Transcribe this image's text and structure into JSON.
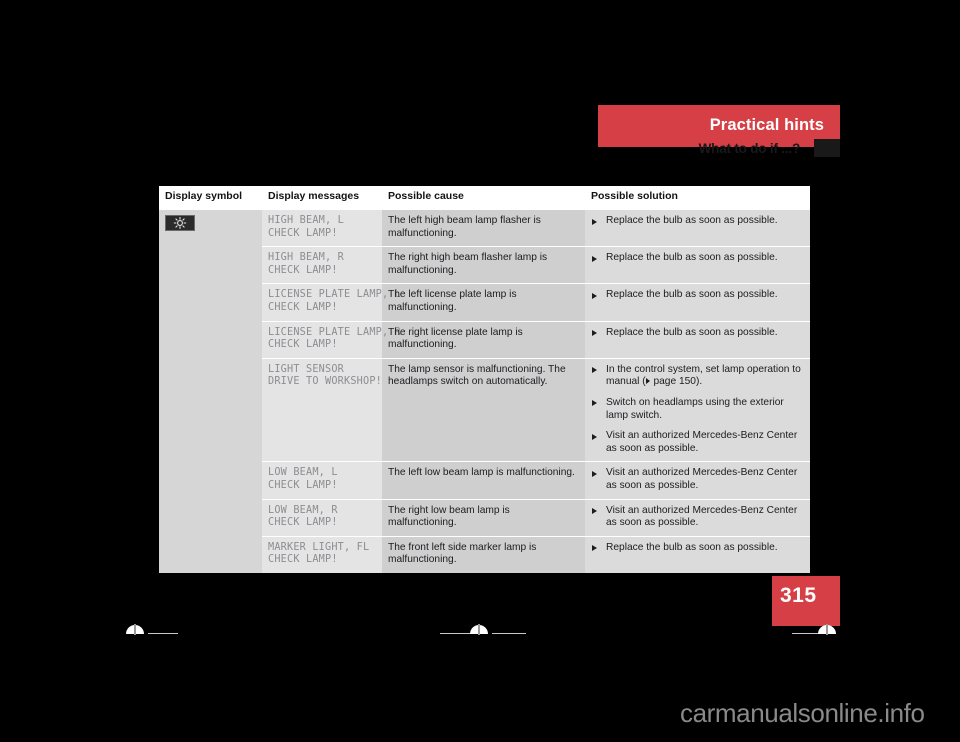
{
  "header": {
    "band_title": "Practical hints",
    "section_title": "What to do if ...?"
  },
  "page": {
    "number": "315"
  },
  "watermark": {
    "text": "carmanualsonline.info"
  },
  "table": {
    "columns": [
      "Display symbol",
      "Display messages",
      "Possible cause",
      "Possible solution"
    ],
    "symbol": {
      "icon_name": "high-beam-lamp-icon"
    },
    "rows": [
      {
        "message_line1": "HIGH BEAM, L",
        "message_line2": "CHECK LAMP!",
        "cause": "The left high beam lamp flasher is malfunctioning.",
        "solutions": [
          {
            "text": "Replace the bulb as soon as possible."
          }
        ]
      },
      {
        "message_line1": "HIGH BEAM, R",
        "message_line2": "CHECK LAMP!",
        "cause": "The right high beam flasher lamp is malfunctioning.",
        "solutions": [
          {
            "text": "Replace the bulb as soon as possible."
          }
        ]
      },
      {
        "message_line1": "LICENSE PLATE LAMP, L",
        "message_line2": "CHECK LAMP!",
        "cause": "The left license plate lamp is malfunctioning.",
        "solutions": [
          {
            "text": "Replace the bulb as soon as possible."
          }
        ]
      },
      {
        "message_line1": "LICENSE PLATE LAMP, R",
        "message_line2": "CHECK LAMP!",
        "cause": "The right license plate lamp is malfunctioning.",
        "solutions": [
          {
            "text": "Replace the bulb as soon as possible."
          }
        ]
      },
      {
        "message_line1": "LIGHT SENSOR",
        "message_line2": "DRIVE TO WORKSHOP!",
        "cause": "The lamp sensor is malfunctioning. The headlamps switch on automatically.",
        "solutions": [
          {
            "text_before_ref": "In the control system, set lamp operation to manual (",
            "ref": " page 150).",
            "has_ref": true
          },
          {
            "text": "Switch on headlamps using the exterior lamp switch."
          },
          {
            "text": "Visit an authorized Mercedes-Benz Center as soon as possible."
          }
        ]
      },
      {
        "message_line1": "LOW BEAM, L",
        "message_line2": "CHECK LAMP!",
        "cause": "The left low beam lamp is malfunctioning.",
        "solutions": [
          {
            "text": "Visit an authorized Mercedes-Benz Center as soon as possible."
          }
        ]
      },
      {
        "message_line1": "LOW BEAM, R",
        "message_line2": "CHECK LAMP!",
        "cause": "The right low beam lamp is malfunctioning.",
        "solutions": [
          {
            "text": "Visit an authorized Mercedes-Benz Center as soon as possible."
          }
        ]
      },
      {
        "message_line1": "MARKER LIGHT, FL",
        "message_line2": "CHECK LAMP!",
        "cause": "The front left side marker lamp is malfunctioning.",
        "solutions": [
          {
            "text": "Replace the bulb as soon as possible."
          }
        ]
      }
    ]
  },
  "colors": {
    "accent_red": "#d63f45",
    "table_symbol_bg": "#d6d6d6",
    "table_message_bg": "#e4e4e4",
    "table_cause_bg": "#cfcfcf",
    "table_solution_bg": "#dbdbdb"
  }
}
